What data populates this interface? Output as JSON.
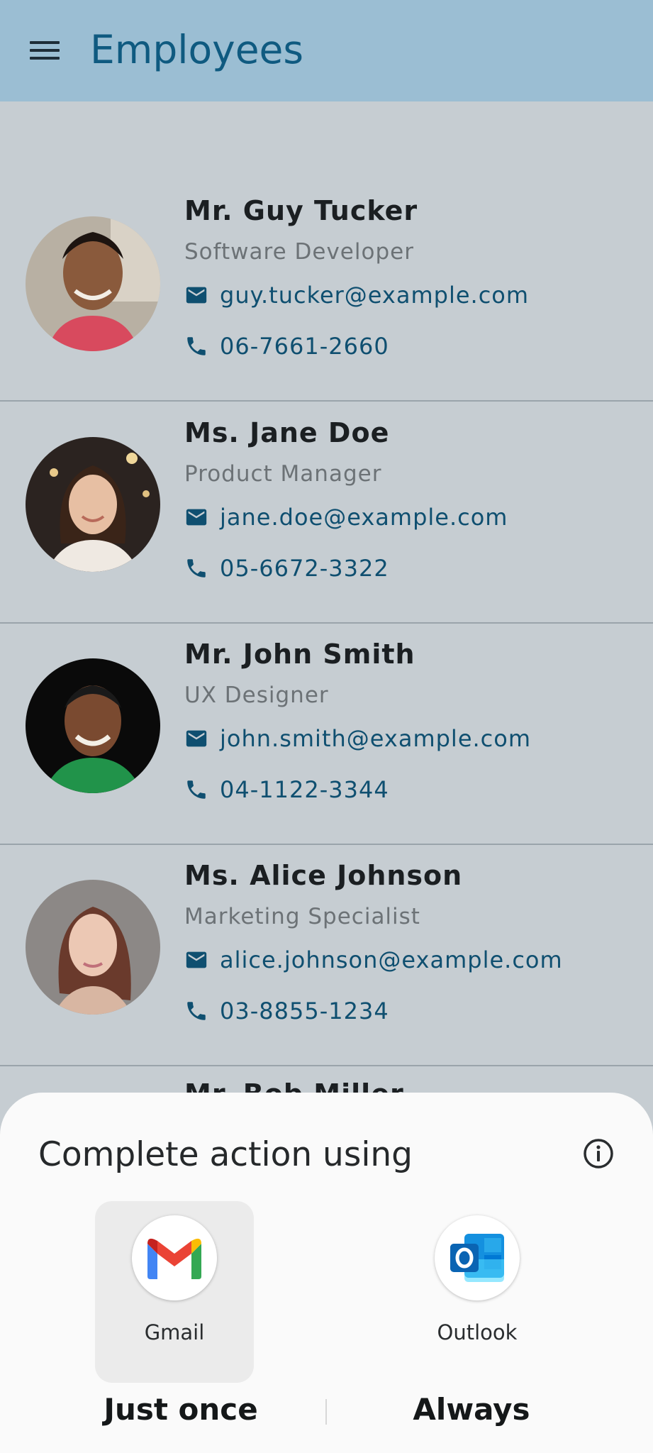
{
  "appbar": {
    "title": "Employees",
    "menu_icon": "hamburger-menu-icon"
  },
  "employees": [
    {
      "name": "Mr. Guy Tucker",
      "role": "Software Developer",
      "email": "guy.tucker@example.com",
      "phone": "06-7661-2660"
    },
    {
      "name": "Ms. Jane Doe",
      "role": "Product Manager",
      "email": "jane.doe@example.com",
      "phone": "05-6672-3322"
    },
    {
      "name": "Mr. John Smith",
      "role": "UX Designer",
      "email": "john.smith@example.com",
      "phone": "04-1122-3344"
    },
    {
      "name": "Ms. Alice Johnson",
      "role": "Marketing Specialist",
      "email": "alice.johnson@example.com",
      "phone": "03-8855-1234"
    }
  ],
  "peek": {
    "name": "Mr. Bob Miller"
  },
  "sheet": {
    "title": "Complete action using",
    "apps": [
      {
        "label": "Gmail",
        "icon": "gmail-icon",
        "selected": true
      },
      {
        "label": "Outlook",
        "icon": "outlook-icon",
        "selected": false
      }
    ],
    "just_once": "Just once",
    "always": "Always"
  },
  "colors": {
    "appbar": "#9bbed3",
    "title": "#0f5a80",
    "link": "#0f4f70",
    "scrim": "#c6cdd2"
  }
}
